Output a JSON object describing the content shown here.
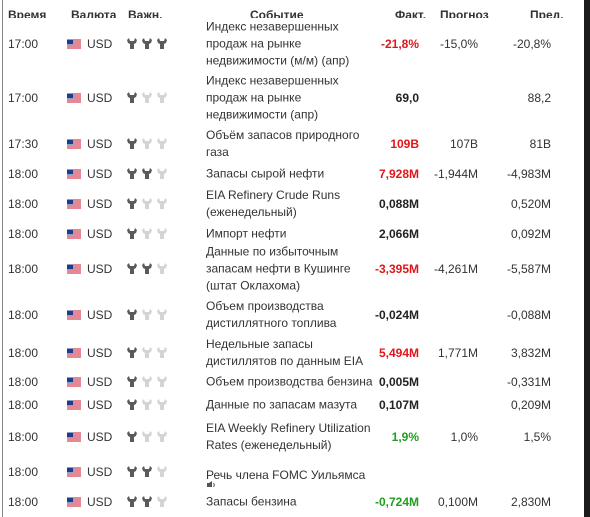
{
  "header": {
    "time": "Время",
    "currency": "Валюта",
    "importance": "Важн.",
    "event": "Событие",
    "actual": "Факт.",
    "forecast": "Прогноз",
    "previous": "Пред."
  },
  "colors": {
    "negative": "#e0161b",
    "positive": "#1f9e1f",
    "neutral": "#222222",
    "bull_on": "#5a5a5a",
    "bull_off": "#d4d4d4"
  },
  "rows": [
    {
      "time": "17:00",
      "currency": "USD",
      "importance": 3,
      "event": "Индекс незавершенных продаж на рынке недвижимости (м/м) (апр)",
      "actual": "-21,8%",
      "actual_color": "red",
      "forecast": "-15,0%",
      "previous": "-20,8%"
    },
    {
      "time": "17:00",
      "currency": "USD",
      "importance": 1,
      "event": "Индекс незавершенных продаж на рынке недвижимости (апр)",
      "actual": "69,0",
      "actual_color": "black",
      "forecast": "",
      "previous": "88,2"
    },
    {
      "time": "17:30",
      "currency": "USD",
      "importance": 1,
      "event": "Объём запасов природного газа",
      "actual": "109B",
      "actual_color": "red",
      "forecast": "107B",
      "previous": "81B"
    },
    {
      "time": "18:00",
      "currency": "USD",
      "importance": 2,
      "event": "Запасы сырой нефти",
      "actual": "7,928M",
      "actual_color": "red",
      "forecast": "-1,944M",
      "previous": "-4,983M"
    },
    {
      "time": "18:00",
      "currency": "USD",
      "importance": 1,
      "event": "EIA Refinery Crude Runs (еженедельный)",
      "actual": "0,088M",
      "actual_color": "black",
      "forecast": "",
      "previous": "0,520M"
    },
    {
      "time": "18:00",
      "currency": "USD",
      "importance": 1,
      "event": "Импорт нефти",
      "actual": "2,066M",
      "actual_color": "black",
      "forecast": "",
      "previous": "0,092M"
    },
    {
      "time": "18:00",
      "currency": "USD",
      "importance": 2,
      "event": "Данные по избыточным запасам нефти в Кушинге (штат Оклахома)",
      "actual": "-3,395M",
      "actual_color": "red",
      "forecast": "-4,261M",
      "previous": "-5,587M"
    },
    {
      "time": "18:00",
      "currency": "USD",
      "importance": 1,
      "event": "Объем производства дистиллятного топлива",
      "actual": "-0,024M",
      "actual_color": "black",
      "forecast": "",
      "previous": "-0,088M"
    },
    {
      "time": "18:00",
      "currency": "USD",
      "importance": 1,
      "event": "Недельные запасы дистиллятов по данным EIA",
      "actual": "5,494M",
      "actual_color": "red",
      "forecast": "1,771M",
      "previous": "3,832M"
    },
    {
      "time": "18:00",
      "currency": "USD",
      "importance": 1,
      "event": "Объем производства бензина",
      "actual": "0,005M",
      "actual_color": "black",
      "forecast": "",
      "previous": "-0,331M"
    },
    {
      "time": "18:00",
      "currency": "USD",
      "importance": 1,
      "event": "Данные по запасам мазута",
      "actual": "0,107M",
      "actual_color": "black",
      "forecast": "",
      "previous": "0,209M"
    },
    {
      "time": "18:00",
      "currency": "USD",
      "importance": 1,
      "event": "EIA Weekly Refinery Utilization Rates (еженедельный)",
      "actual": "1,9%",
      "actual_color": "green",
      "forecast": "1,0%",
      "previous": "1,5%"
    },
    {
      "time": "18:00",
      "currency": "USD",
      "importance": 2,
      "event": "Речь члена FOMC Уильямса",
      "actual": "",
      "actual_color": "black",
      "forecast": "",
      "previous": "",
      "speaker_icon": true
    },
    {
      "time": "18:00",
      "currency": "USD",
      "importance": 2,
      "event": "Запасы бензина",
      "actual": "-0,724M",
      "actual_color": "green",
      "forecast": "0,100M",
      "previous": "2,830M"
    }
  ]
}
